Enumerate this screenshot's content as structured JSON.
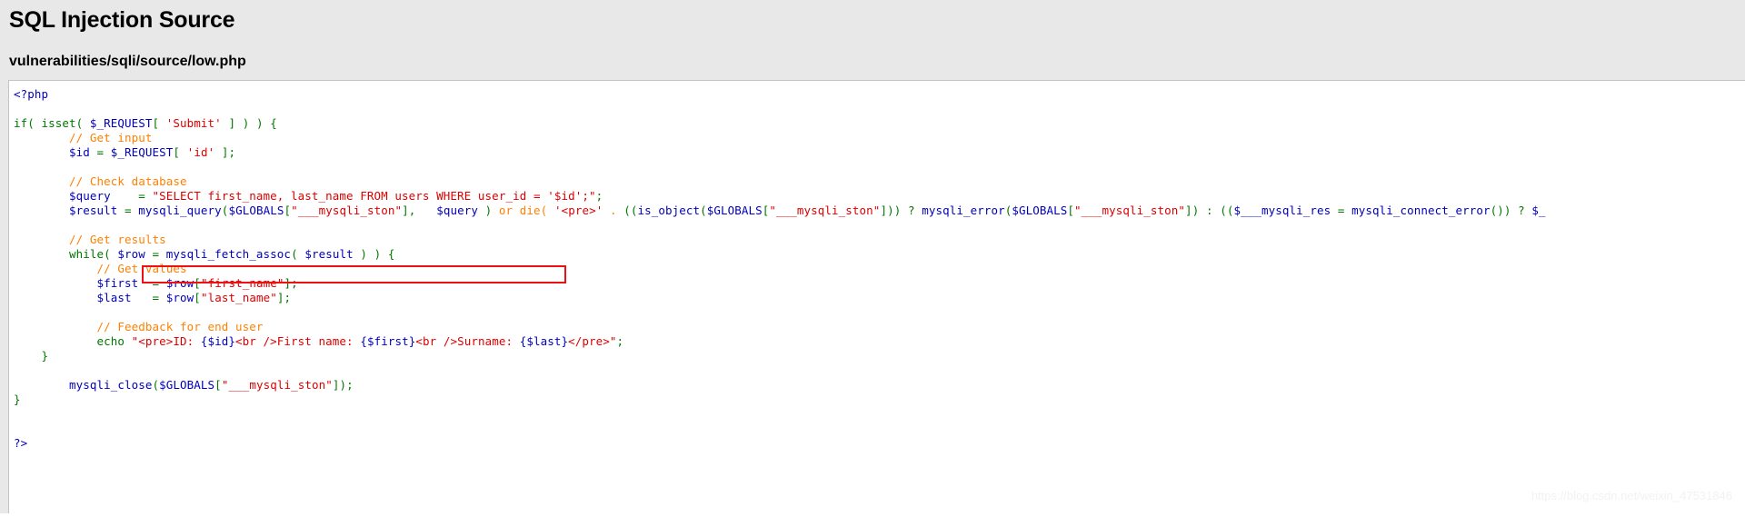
{
  "header": {
    "title": "SQL Injection Source",
    "file_path": "vulnerabilities/sqli/source/low.php"
  },
  "watermark": {
    "text": "https://blog.csdn.net/weixin_47531846"
  },
  "highlight": {
    "color": "#ee1111",
    "target_text": "\"SELECT first_name, last_name FROM users WHERE user_id = '$id';\";"
  },
  "code": {
    "language": "php",
    "lines": [
      {
        "id": "line-1",
        "tokens": [
          {
            "cls": "c-tag",
            "t": "<?php"
          }
        ]
      },
      {
        "id": "line-2",
        "tokens": []
      },
      {
        "id": "line-3",
        "tokens": [
          {
            "cls": "c-kw",
            "t": "if( isset( "
          },
          {
            "cls": "c-var",
            "t": "$_REQUEST"
          },
          {
            "cls": "c-br",
            "t": "[ "
          },
          {
            "cls": "c-str",
            "t": "'Submit'"
          },
          {
            "cls": "c-br",
            "t": " ]"
          },
          {
            "cls": "c-kw",
            "t": " ) ) {"
          }
        ]
      },
      {
        "id": "line-4",
        "tokens": [
          {
            "cls": "c-com",
            "t": "        // Get input"
          }
        ]
      },
      {
        "id": "line-5",
        "tokens": [
          {
            "cls": "c-var",
            "t": "        $id"
          },
          {
            "cls": "c-kw",
            "t": " = "
          },
          {
            "cls": "c-var",
            "t": "$_REQUEST"
          },
          {
            "cls": "c-br",
            "t": "[ "
          },
          {
            "cls": "c-str",
            "t": "'id'"
          },
          {
            "cls": "c-br",
            "t": " ]"
          },
          {
            "cls": "c-kw",
            "t": ";"
          }
        ]
      },
      {
        "id": "line-6",
        "tokens": []
      },
      {
        "id": "line-7",
        "tokens": [
          {
            "cls": "c-com",
            "t": "        // Check database"
          }
        ]
      },
      {
        "id": "line-8",
        "tokens": [
          {
            "cls": "c-var",
            "t": "        $query"
          },
          {
            "cls": "c-kw",
            "t": "    = "
          },
          {
            "cls": "c-str",
            "t": "\"SELECT first_name, last_name FROM users WHERE user_id = '$id';\""
          },
          {
            "cls": "c-kw",
            "t": ";"
          }
        ]
      },
      {
        "id": "line-9",
        "tokens": [
          {
            "cls": "c-var",
            "t": "        $result"
          },
          {
            "cls": "c-kw",
            "t": " = "
          },
          {
            "cls": "c-fn",
            "t": "mysqli_query"
          },
          {
            "cls": "c-kw",
            "t": "("
          },
          {
            "cls": "c-var",
            "t": "$GLOBALS"
          },
          {
            "cls": "c-br",
            "t": "["
          },
          {
            "cls": "c-str",
            "t": "\"___mysqli_ston\""
          },
          {
            "cls": "c-br",
            "t": "]"
          },
          {
            "cls": "c-kw",
            "t": ",   "
          },
          {
            "cls": "c-var",
            "t": "$query"
          },
          {
            "cls": "c-kw",
            "t": " ) "
          },
          {
            "cls": "c-com",
            "t": "or die( "
          },
          {
            "cls": "c-str",
            "t": "'<pre>'"
          },
          {
            "cls": "c-com",
            "t": " . "
          },
          {
            "cls": "c-kw",
            "t": "(("
          },
          {
            "cls": "c-fn",
            "t": "is_object"
          },
          {
            "cls": "c-kw",
            "t": "("
          },
          {
            "cls": "c-var",
            "t": "$GLOBALS"
          },
          {
            "cls": "c-br",
            "t": "["
          },
          {
            "cls": "c-str",
            "t": "\"___mysqli_ston\""
          },
          {
            "cls": "c-br",
            "t": "]"
          },
          {
            "cls": "c-kw",
            "t": ")) ? "
          },
          {
            "cls": "c-fn",
            "t": "mysqli_error"
          },
          {
            "cls": "c-kw",
            "t": "("
          },
          {
            "cls": "c-var",
            "t": "$GLOBALS"
          },
          {
            "cls": "c-br",
            "t": "["
          },
          {
            "cls": "c-str",
            "t": "\"___mysqli_ston\""
          },
          {
            "cls": "c-br",
            "t": "]"
          },
          {
            "cls": "c-kw",
            "t": ") : (("
          },
          {
            "cls": "c-var",
            "t": "$___mysqli_res"
          },
          {
            "cls": "c-kw",
            "t": " = "
          },
          {
            "cls": "c-fn",
            "t": "mysqli_connect_error"
          },
          {
            "cls": "c-kw",
            "t": "()) ? "
          },
          {
            "cls": "c-var",
            "t": "$_"
          }
        ]
      },
      {
        "id": "line-10",
        "tokens": []
      },
      {
        "id": "line-11",
        "tokens": [
          {
            "cls": "c-com",
            "t": "        // Get results"
          }
        ]
      },
      {
        "id": "line-12",
        "tokens": [
          {
            "cls": "c-kw",
            "t": "        while( "
          },
          {
            "cls": "c-var",
            "t": "$row"
          },
          {
            "cls": "c-kw",
            "t": " = "
          },
          {
            "cls": "c-fn",
            "t": "mysqli_fetch_assoc"
          },
          {
            "cls": "c-kw",
            "t": "( "
          },
          {
            "cls": "c-var",
            "t": "$result"
          },
          {
            "cls": "c-kw",
            "t": " ) ) {"
          }
        ]
      },
      {
        "id": "line-13",
        "tokens": [
          {
            "cls": "c-com",
            "t": "            // Get values"
          }
        ]
      },
      {
        "id": "line-14",
        "tokens": [
          {
            "cls": "c-var",
            "t": "            $first"
          },
          {
            "cls": "c-kw",
            "t": "  = "
          },
          {
            "cls": "c-var",
            "t": "$row"
          },
          {
            "cls": "c-br",
            "t": "["
          },
          {
            "cls": "c-str",
            "t": "\"first_name\""
          },
          {
            "cls": "c-br",
            "t": "]"
          },
          {
            "cls": "c-kw",
            "t": ";"
          }
        ]
      },
      {
        "id": "line-15",
        "tokens": [
          {
            "cls": "c-var",
            "t": "            $last"
          },
          {
            "cls": "c-kw",
            "t": "   = "
          },
          {
            "cls": "c-var",
            "t": "$row"
          },
          {
            "cls": "c-br",
            "t": "["
          },
          {
            "cls": "c-str",
            "t": "\"last_name\""
          },
          {
            "cls": "c-br",
            "t": "]"
          },
          {
            "cls": "c-kw",
            "t": ";"
          }
        ]
      },
      {
        "id": "line-16",
        "tokens": []
      },
      {
        "id": "line-17",
        "tokens": [
          {
            "cls": "c-com",
            "t": "            // Feedback for end user"
          }
        ]
      },
      {
        "id": "line-18",
        "tokens": [
          {
            "cls": "c-kw",
            "t": "            echo "
          },
          {
            "cls": "c-str",
            "t": "\"<pre>ID: "
          },
          {
            "cls": "c-var",
            "t": "{$id}"
          },
          {
            "cls": "c-str",
            "t": "<br />First name: "
          },
          {
            "cls": "c-var",
            "t": "{$first}"
          },
          {
            "cls": "c-str",
            "t": "<br />Surname: "
          },
          {
            "cls": "c-var",
            "t": "{$last}"
          },
          {
            "cls": "c-str",
            "t": "</pre>\""
          },
          {
            "cls": "c-kw",
            "t": ";"
          }
        ]
      },
      {
        "id": "line-19",
        "tokens": [
          {
            "cls": "c-kw",
            "t": "    }"
          }
        ]
      },
      {
        "id": "line-20",
        "tokens": []
      },
      {
        "id": "line-21",
        "tokens": [
          {
            "cls": "c-fn",
            "t": "        mysqli_close"
          },
          {
            "cls": "c-kw",
            "t": "("
          },
          {
            "cls": "c-var",
            "t": "$GLOBALS"
          },
          {
            "cls": "c-br",
            "t": "["
          },
          {
            "cls": "c-str",
            "t": "\"___mysqli_ston\""
          },
          {
            "cls": "c-br",
            "t": "]"
          },
          {
            "cls": "c-kw",
            "t": ");"
          }
        ]
      },
      {
        "id": "line-22",
        "tokens": [
          {
            "cls": "c-kw",
            "t": "}"
          }
        ]
      },
      {
        "id": "line-23",
        "tokens": []
      },
      {
        "id": "line-24",
        "tokens": []
      },
      {
        "id": "line-25",
        "tokens": [
          {
            "cls": "c-var",
            "t": "?>"
          }
        ]
      }
    ]
  }
}
